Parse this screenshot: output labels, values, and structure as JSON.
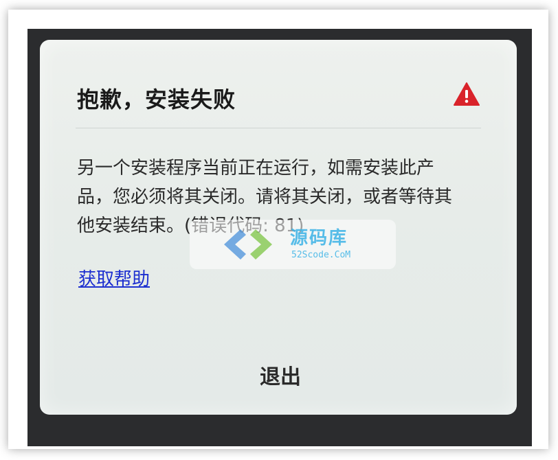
{
  "dialog": {
    "title": "抱歉，安装失败",
    "message": "另一个安装程序当前正在运行，如需安装此产品，您必须将其关闭。请将其关闭，或者等待其他安装结束。(错误代码: 81)",
    "help_link": "获取帮助",
    "exit_button": "退出",
    "icon": "warning-triangle-icon",
    "icon_color": "#d9232a"
  },
  "watermark": {
    "text": "源码库",
    "url": "52Scode.CoM",
    "color": "#3bb3e6"
  }
}
